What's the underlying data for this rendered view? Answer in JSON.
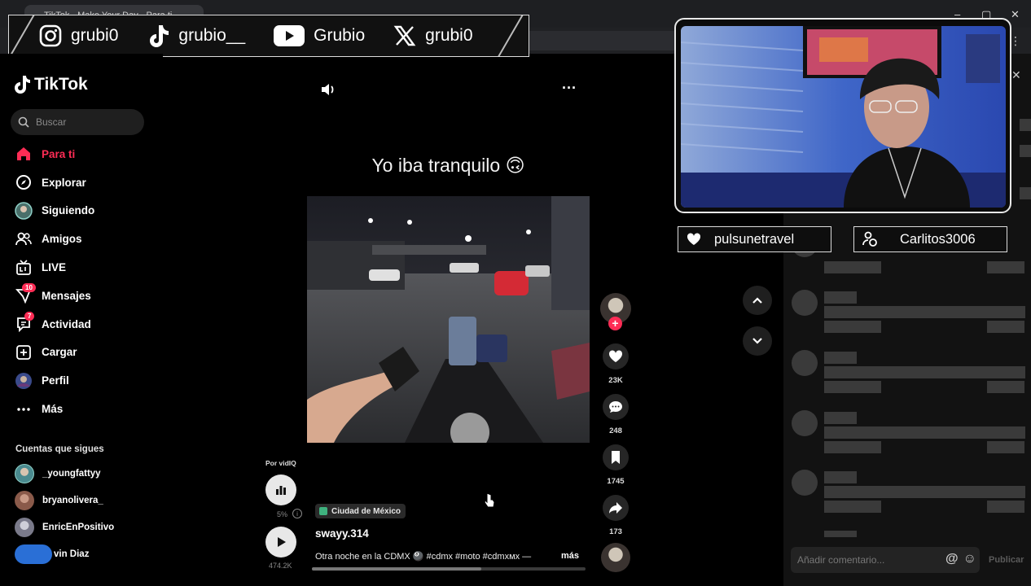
{
  "browser": {
    "tab_title": "TikTok - Make Your Day - Para ti",
    "window_controls": [
      "–",
      "▢",
      "✕"
    ]
  },
  "social_banner": [
    {
      "icon": "instagram-icon",
      "handle": "grubi0"
    },
    {
      "icon": "tiktok-icon",
      "handle": "grubio__"
    },
    {
      "icon": "youtube-icon",
      "handle": "Grubio"
    },
    {
      "icon": "x-icon",
      "handle": "grubi0"
    }
  ],
  "tiktok": {
    "logo_text": "TikTok",
    "search_placeholder": "Buscar",
    "nav": [
      {
        "label": "Para ti",
        "icon": "home-icon",
        "active": true
      },
      {
        "label": "Explorar",
        "icon": "compass-icon"
      },
      {
        "label": "Siguiendo",
        "icon": "following-avatar-icon"
      },
      {
        "label": "Amigos",
        "icon": "friends-icon"
      },
      {
        "label": "LIVE",
        "icon": "live-icon"
      },
      {
        "label": "Mensajes",
        "icon": "messages-icon",
        "badge": "10"
      },
      {
        "label": "Actividad",
        "icon": "activity-icon",
        "badge": "7"
      },
      {
        "label": "Cargar",
        "icon": "upload-icon"
      },
      {
        "label": "Perfil",
        "icon": "profile-avatar-icon"
      },
      {
        "label": "Más",
        "icon": "more-dots-icon"
      }
    ],
    "following_title": "Cuentas que sigues",
    "following": [
      {
        "name": "_youngfattyy",
        "color": "#4a8a8f"
      },
      {
        "name": "bryanolivera_",
        "color": "#8a5a4a"
      },
      {
        "name": "EnricEnPositivo",
        "color": "#7a7a8a"
      },
      {
        "name": "vin Diaz",
        "color": "#2a6fd6"
      }
    ]
  },
  "video": {
    "caption": "Yo iba tranquilo 🙃",
    "vidiq_label": "Por vidIQ",
    "vidiq_pct": "5%",
    "views": "474.2K",
    "location": "Ciudad de México",
    "author": "swayy.314",
    "description": "Otra noche en la CDMX 🎱 #cdmx #moto #cdmxмx —",
    "more_label": "más",
    "progress": 0.62
  },
  "actions": {
    "likes": "23K",
    "comments": "248",
    "saves": "1745",
    "shares": "173"
  },
  "comments_panel": {
    "input_placeholder": "Añadir comentario...",
    "publish_label": "Publicar"
  },
  "overlay_tags": [
    {
      "icon": "heart-icon",
      "name": "pulsunetravel"
    },
    {
      "icon": "user-coin-icon",
      "name": "Carlitos3006"
    }
  ],
  "colors": {
    "accent": "#fe2c55",
    "background": "#000000",
    "panel": "#121212"
  }
}
